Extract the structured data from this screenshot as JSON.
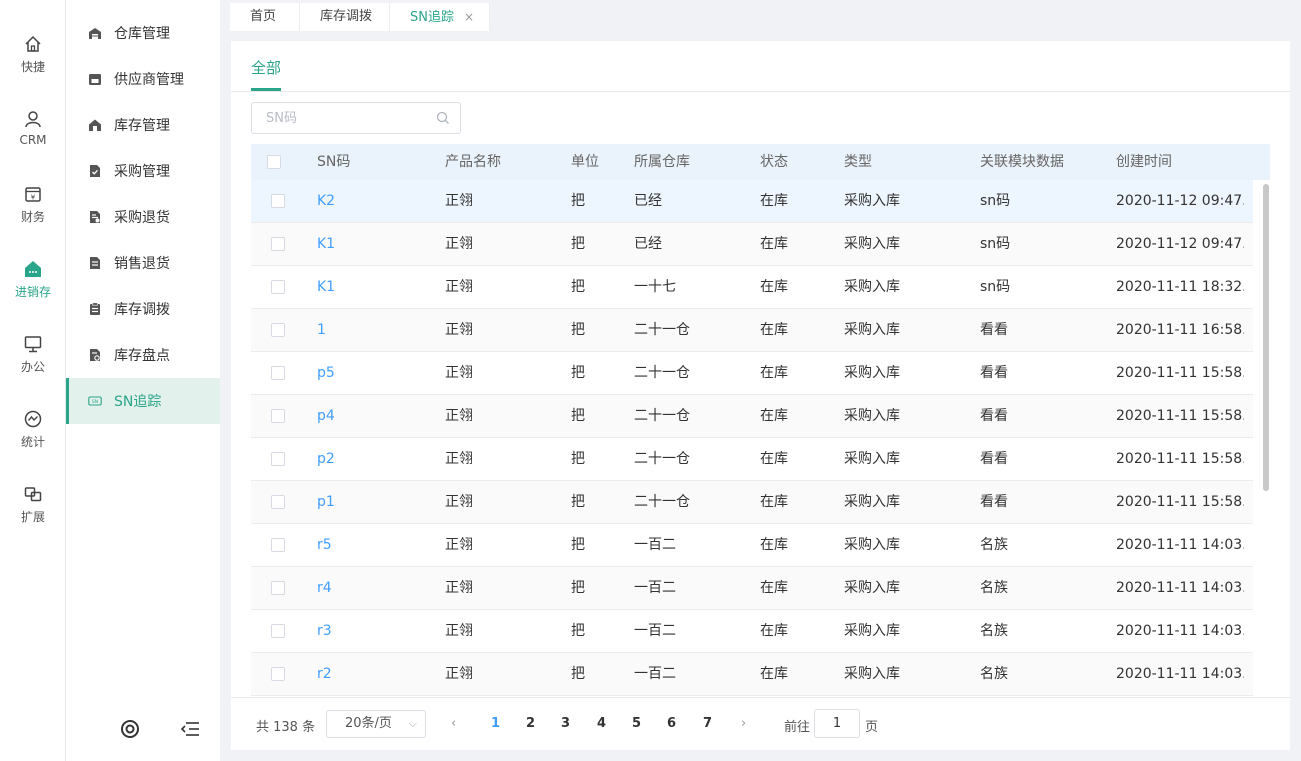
{
  "rail": [
    {
      "label": "快捷",
      "icon": "home-icon"
    },
    {
      "label": "CRM",
      "icon": "user-icon"
    },
    {
      "label": "财务",
      "icon": "finance-icon"
    },
    {
      "label": "进销存",
      "icon": "store-icon"
    },
    {
      "label": "办公",
      "icon": "monitor-icon"
    },
    {
      "label": "统计",
      "icon": "chart-icon"
    },
    {
      "label": "扩展",
      "icon": "extend-icon"
    }
  ],
  "rail_active_index": 3,
  "submenu": [
    {
      "label": "仓库管理",
      "icon": "warehouse-icon"
    },
    {
      "label": "供应商管理",
      "icon": "supplier-icon"
    },
    {
      "label": "库存管理",
      "icon": "inventory-icon"
    },
    {
      "label": "采购管理",
      "icon": "purchase-icon"
    },
    {
      "label": "采购退货",
      "icon": "purchase-return-icon"
    },
    {
      "label": "销售退货",
      "icon": "sales-return-icon"
    },
    {
      "label": "库存调拨",
      "icon": "transfer-icon"
    },
    {
      "label": "库存盘点",
      "icon": "stocktake-icon"
    },
    {
      "label": "SN追踪",
      "icon": "sn-icon"
    }
  ],
  "submenu_active_index": 8,
  "tabs": [
    {
      "label": "首页"
    },
    {
      "label": "库存调拨"
    },
    {
      "label": "SN追踪",
      "close": "×"
    }
  ],
  "subtab": {
    "label": "全部"
  },
  "search": {
    "placeholder": "SN码"
  },
  "table": {
    "columns": [
      "SN码",
      "产品名称",
      "单位",
      "所属仓库",
      "状态",
      "类型",
      "关联模块数据",
      "创建时间"
    ],
    "rows": [
      [
        "K2",
        "正翎",
        "把",
        "已经",
        "在库",
        "采购入库",
        "sn码",
        "2020-11-12 09:47..."
      ],
      [
        "K1",
        "正翎",
        "把",
        "已经",
        "在库",
        "采购入库",
        "sn码",
        "2020-11-12 09:47..."
      ],
      [
        "K1",
        "正翎",
        "把",
        "一十七",
        "在库",
        "采购入库",
        "sn码",
        "2020-11-11 18:32..."
      ],
      [
        "1",
        "正翎",
        "把",
        "二十一仓",
        "在库",
        "采购入库",
        "看看",
        "2020-11-11 16:58..."
      ],
      [
        "p5",
        "正翎",
        "把",
        "二十一仓",
        "在库",
        "采购入库",
        "看看",
        "2020-11-11 15:58..."
      ],
      [
        "p4",
        "正翎",
        "把",
        "二十一仓",
        "在库",
        "采购入库",
        "看看",
        "2020-11-11 15:58..."
      ],
      [
        "p2",
        "正翎",
        "把",
        "二十一仓",
        "在库",
        "采购入库",
        "看看",
        "2020-11-11 15:58..."
      ],
      [
        "p1",
        "正翎",
        "把",
        "二十一仓",
        "在库",
        "采购入库",
        "看看",
        "2020-11-11 15:58..."
      ],
      [
        "r5",
        "正翎",
        "把",
        "一百二",
        "在库",
        "采购入库",
        "名族",
        "2020-11-11 14:03..."
      ],
      [
        "r4",
        "正翎",
        "把",
        "一百二",
        "在库",
        "采购入库",
        "名族",
        "2020-11-11 14:03..."
      ],
      [
        "r3",
        "正翎",
        "把",
        "一百二",
        "在库",
        "采购入库",
        "名族",
        "2020-11-11 14:03..."
      ],
      [
        "r2",
        "正翎",
        "把",
        "一百二",
        "在库",
        "采购入库",
        "名族",
        "2020-11-11 14:03..."
      ]
    ]
  },
  "pagination": {
    "total": "共 138 条",
    "page_size": "20条/页",
    "pages": [
      "1",
      "2",
      "3",
      "4",
      "5",
      "6",
      "7"
    ],
    "current": "1",
    "prev": "‹",
    "next": "›",
    "goto_label": "前往",
    "goto_value": "1",
    "page_word": "页"
  },
  "colors": {
    "accent": "#2aa58a",
    "link": "#409eff",
    "header_bg": "#eaf2fc"
  }
}
